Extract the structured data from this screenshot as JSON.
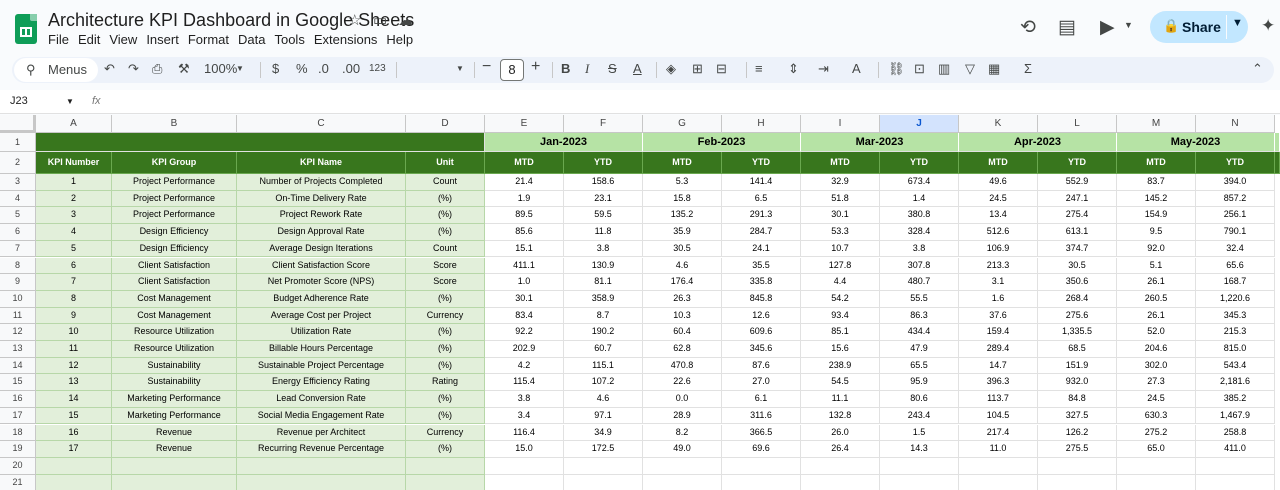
{
  "doc": {
    "title": "Architecture KPI Dashboard in Google Sheets",
    "menu": [
      "File",
      "Edit",
      "View",
      "Insert",
      "Format",
      "Data",
      "Tools",
      "Extensions",
      "Help"
    ],
    "share_label": "Share"
  },
  "toolbar": {
    "menus_label": "Menus",
    "zoom": "100%",
    "currency": "$",
    "percent": "%",
    "dec_dec": ".0",
    "dec_inc": ".00",
    "format_123": "123",
    "font_size": "8"
  },
  "formula_bar": {
    "name_box": "J23",
    "fx": "fx"
  },
  "sheet": {
    "columns": [
      "A",
      "B",
      "C",
      "D",
      "E",
      "F",
      "G",
      "H",
      "I",
      "J",
      "K",
      "L",
      "M",
      "N"
    ],
    "selected_column": "J",
    "row_numbers": [
      "1",
      "2",
      "3",
      "4",
      "5",
      "6",
      "7",
      "8",
      "9",
      "10",
      "11",
      "12",
      "13",
      "14",
      "15",
      "16",
      "17",
      "18",
      "19",
      "20",
      "21"
    ],
    "months": [
      "Jan-2023",
      "Feb-2023",
      "Mar-2023",
      "Apr-2023",
      "May-2023"
    ],
    "headers": [
      "KPI Number",
      "KPI Group",
      "KPI Name",
      "Unit",
      "MTD",
      "YTD",
      "MTD",
      "YTD",
      "MTD",
      "YTD",
      "MTD",
      "YTD",
      "MTD",
      "YTD"
    ],
    "rows": [
      [
        "1",
        "Project Performance",
        "Number of Projects Completed",
        "Count",
        "21.4",
        "158.6",
        "5.3",
        "141.4",
        "32.9",
        "673.4",
        "49.6",
        "552.9",
        "83.7",
        "394.0"
      ],
      [
        "2",
        "Project Performance",
        "On-Time Delivery Rate",
        "(%)",
        "1.9",
        "23.1",
        "15.8",
        "6.5",
        "51.8",
        "1.4",
        "24.5",
        "247.1",
        "145.2",
        "857.2"
      ],
      [
        "3",
        "Project Performance",
        "Project Rework Rate",
        "(%)",
        "89.5",
        "59.5",
        "135.2",
        "291.3",
        "30.1",
        "380.8",
        "13.4",
        "275.4",
        "154.9",
        "256.1"
      ],
      [
        "4",
        "Design Efficiency",
        "Design Approval Rate",
        "(%)",
        "85.6",
        "11.8",
        "35.9",
        "284.7",
        "53.3",
        "328.4",
        "512.6",
        "613.1",
        "9.5",
        "790.1"
      ],
      [
        "5",
        "Design Efficiency",
        "Average Design Iterations",
        "Count",
        "15.1",
        "3.8",
        "30.5",
        "24.1",
        "10.7",
        "3.8",
        "106.9",
        "374.7",
        "92.0",
        "32.4"
      ],
      [
        "6",
        "Client Satisfaction",
        "Client Satisfaction Score",
        "Score",
        "411.1",
        "130.9",
        "4.6",
        "35.5",
        "127.8",
        "307.8",
        "213.3",
        "30.5",
        "5.1",
        "65.6"
      ],
      [
        "7",
        "Client Satisfaction",
        "Net Promoter Score (NPS)",
        "Score",
        "1.0",
        "81.1",
        "176.4",
        "335.8",
        "4.4",
        "480.7",
        "3.1",
        "350.6",
        "26.1",
        "168.7"
      ],
      [
        "8",
        "Cost Management",
        "Budget Adherence Rate",
        "(%)",
        "30.1",
        "358.9",
        "26.3",
        "845.8",
        "54.2",
        "55.5",
        "1.6",
        "268.4",
        "260.5",
        "1,220.6"
      ],
      [
        "9",
        "Cost Management",
        "Average Cost per Project",
        "Currency",
        "83.4",
        "8.7",
        "10.3",
        "12.6",
        "93.4",
        "86.3",
        "37.6",
        "275.6",
        "26.1",
        "345.3"
      ],
      [
        "10",
        "Resource Utilization",
        "Utilization Rate",
        "(%)",
        "92.2",
        "190.2",
        "60.4",
        "609.6",
        "85.1",
        "434.4",
        "159.4",
        "1,335.5",
        "52.0",
        "215.3"
      ],
      [
        "11",
        "Resource Utilization",
        "Billable Hours Percentage",
        "(%)",
        "202.9",
        "60.7",
        "62.8",
        "345.6",
        "15.6",
        "47.9",
        "289.4",
        "68.5",
        "204.6",
        "815.0"
      ],
      [
        "12",
        "Sustainability",
        "Sustainable Project Percentage",
        "(%)",
        "4.2",
        "115.1",
        "470.8",
        "87.6",
        "238.9",
        "65.5",
        "14.7",
        "151.9",
        "302.0",
        "543.4"
      ],
      [
        "13",
        "Sustainability",
        "Energy Efficiency Rating",
        "Rating",
        "115.4",
        "107.2",
        "22.6",
        "27.0",
        "54.5",
        "95.9",
        "396.3",
        "932.0",
        "27.3",
        "2,181.6"
      ],
      [
        "14",
        "Marketing Performance",
        "Lead Conversion Rate",
        "(%)",
        "3.8",
        "4.6",
        "0.0",
        "6.1",
        "11.1",
        "80.6",
        "113.7",
        "84.8",
        "24.5",
        "385.2"
      ],
      [
        "15",
        "Marketing Performance",
        "Social Media Engagement Rate",
        "(%)",
        "3.4",
        "97.1",
        "28.9",
        "311.6",
        "132.8",
        "243.4",
        "104.5",
        "327.5",
        "630.3",
        "1,467.9"
      ],
      [
        "16",
        "Revenue",
        "Revenue per Architect",
        "Currency",
        "116.4",
        "34.9",
        "8.2",
        "366.5",
        "26.0",
        "1.5",
        "217.4",
        "126.2",
        "275.2",
        "258.8"
      ],
      [
        "17",
        "Revenue",
        "Recurring Revenue Percentage",
        "(%)",
        "15.0",
        "172.5",
        "49.0",
        "69.6",
        "26.4",
        "14.3",
        "11.0",
        "275.5",
        "65.0",
        "411.0"
      ]
    ]
  }
}
